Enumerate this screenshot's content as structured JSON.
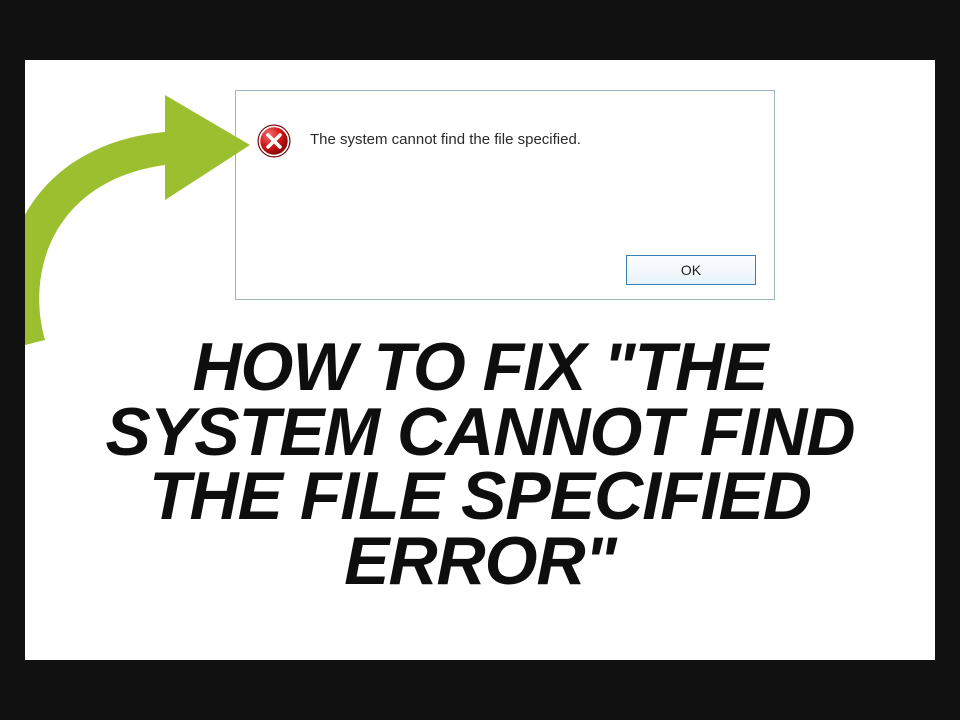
{
  "dialog": {
    "message": "The system cannot find the file specified.",
    "ok_label": "OK"
  },
  "headline": "HOW TO FIX \"THE SYSTEM CANNOT FIND THE FILE SPECIFIED ERROR\""
}
